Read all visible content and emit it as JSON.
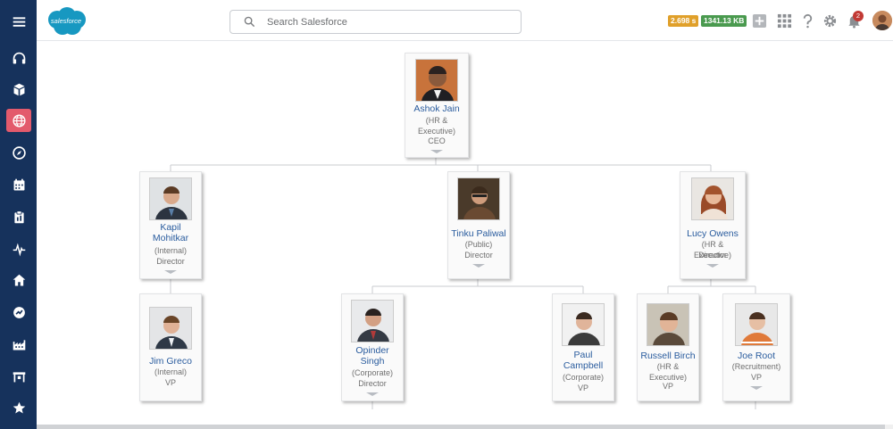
{
  "app": {
    "logo_text": "salesforce",
    "search_placeholder": "Search Salesforce",
    "metrics": {
      "time": "2.698 s",
      "memory": "1341.13 KB"
    },
    "notification_count": "2",
    "colors": {
      "rail": "#16325c",
      "active_rail": "#e35a6c",
      "link": "#2a5c9e"
    }
  },
  "rail": [
    {
      "icon": "headset-icon",
      "active": false
    },
    {
      "icon": "cube-icon",
      "active": false
    },
    {
      "icon": "globe-icon",
      "active": true
    },
    {
      "icon": "compass-icon",
      "active": false
    },
    {
      "icon": "calendar-icon",
      "active": false
    },
    {
      "icon": "clipboard-icon",
      "active": false
    },
    {
      "icon": "pulse-icon",
      "active": false
    },
    {
      "icon": "home-icon",
      "active": false
    },
    {
      "icon": "gauge-icon",
      "active": false
    },
    {
      "icon": "factory-icon",
      "active": false
    },
    {
      "icon": "storefront-icon",
      "active": false
    },
    {
      "icon": "star-icon",
      "active": false
    }
  ],
  "org": {
    "ceo": {
      "name": "Ashok Jain",
      "dept": "(HR & Executive)",
      "title": "CEO"
    },
    "kapil": {
      "name": "Kapil Mohitkar",
      "dept": "(Internal)",
      "title": "Director"
    },
    "tinku": {
      "name": "Tinku Paliwal",
      "dept": "(Public)",
      "title": "Director"
    },
    "lucy": {
      "name": "Lucy Owens",
      "dept": "(HR & Executive)",
      "title": "Director"
    },
    "jim": {
      "name": "Jim Greco",
      "dept": "(Internal)",
      "title": "VP"
    },
    "opinder": {
      "name": "Opinder Singh",
      "dept": "(Corporate)",
      "title": "Director"
    },
    "paul": {
      "name": "Paul Campbell",
      "dept": "(Corporate)",
      "title": "VP"
    },
    "russell": {
      "name": "Russell Birch",
      "dept": "(HR & Executive)",
      "title": "VP"
    },
    "joe": {
      "name": "Joe Root",
      "dept": "(Recruitment)",
      "title": "VP"
    }
  }
}
